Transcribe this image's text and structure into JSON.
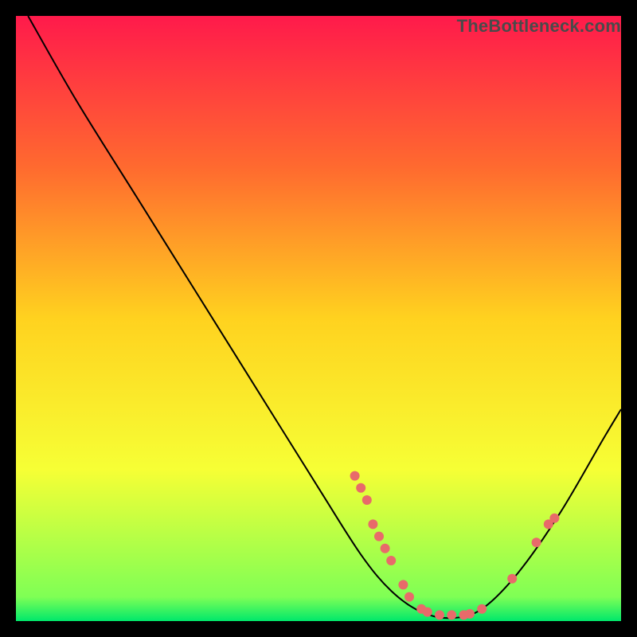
{
  "watermark": "TheBottleneck.com",
  "chart_data": {
    "type": "line",
    "title": "",
    "xlabel": "",
    "ylabel": "",
    "xlim": [
      0,
      100
    ],
    "ylim": [
      0,
      100
    ],
    "background_gradient": {
      "stops": [
        {
          "offset": 0,
          "color": "#ff1a4b"
        },
        {
          "offset": 25,
          "color": "#ff6a2f"
        },
        {
          "offset": 50,
          "color": "#ffd21f"
        },
        {
          "offset": 75,
          "color": "#f6ff35"
        },
        {
          "offset": 96,
          "color": "#7fff55"
        },
        {
          "offset": 100,
          "color": "#00e86b"
        }
      ]
    },
    "curve": [
      {
        "x": 2,
        "y": 100
      },
      {
        "x": 10,
        "y": 86
      },
      {
        "x": 20,
        "y": 70
      },
      {
        "x": 30,
        "y": 54
      },
      {
        "x": 40,
        "y": 38
      },
      {
        "x": 50,
        "y": 22
      },
      {
        "x": 57,
        "y": 11
      },
      {
        "x": 62,
        "y": 5
      },
      {
        "x": 67,
        "y": 1.5
      },
      {
        "x": 72,
        "y": 0.5
      },
      {
        "x": 77,
        "y": 2
      },
      {
        "x": 83,
        "y": 8
      },
      {
        "x": 90,
        "y": 18
      },
      {
        "x": 97,
        "y": 30
      },
      {
        "x": 100,
        "y": 35
      }
    ],
    "markers": [
      {
        "x": 56,
        "y": 24
      },
      {
        "x": 57,
        "y": 22
      },
      {
        "x": 58,
        "y": 20
      },
      {
        "x": 59,
        "y": 16
      },
      {
        "x": 60,
        "y": 14
      },
      {
        "x": 61,
        "y": 12
      },
      {
        "x": 62,
        "y": 10
      },
      {
        "x": 64,
        "y": 6
      },
      {
        "x": 65,
        "y": 4
      },
      {
        "x": 67,
        "y": 2
      },
      {
        "x": 68,
        "y": 1.5
      },
      {
        "x": 70,
        "y": 1
      },
      {
        "x": 72,
        "y": 1
      },
      {
        "x": 74,
        "y": 1
      },
      {
        "x": 75,
        "y": 1.2
      },
      {
        "x": 77,
        "y": 2
      },
      {
        "x": 82,
        "y": 7
      },
      {
        "x": 86,
        "y": 13
      },
      {
        "x": 88,
        "y": 16
      },
      {
        "x": 89,
        "y": 17
      }
    ],
    "marker_color": "#e86a6a",
    "curve_color": "#000000"
  }
}
